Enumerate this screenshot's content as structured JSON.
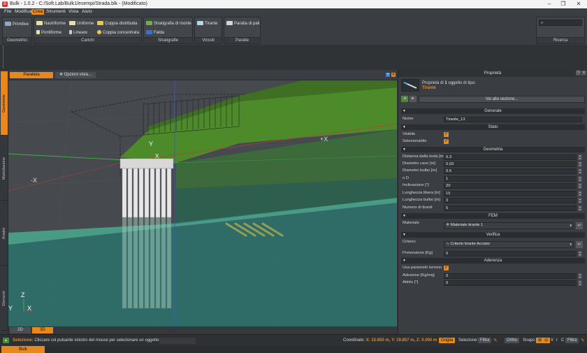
{
  "window": {
    "app_icon": "B",
    "title": "Bulk - 1.0.2 - C:/Soft.Lab/Bulk1/esempi/Strada.blk - (Modificato)",
    "minimize_glyph": "–",
    "maximize_glyph": "❐",
    "close_glyph": "✕"
  },
  "menu": [
    "File",
    "Modifica",
    "Crea",
    "Strumenti",
    "Vista",
    "Aiuto"
  ],
  "menu_active_index": 2,
  "ribbon": {
    "geometrici": {
      "label": "Geometrici",
      "primitive": "Primitive"
    },
    "carichi": {
      "label": "Carichi",
      "nastriforme": "Nastriforme",
      "uniforme": "Uniforme",
      "coppia_distribuita": "Coppia distribuita",
      "puntiforme": "Puntiforme",
      "lineare": "Lineare",
      "coppia_concentrata": "Coppia concentrata"
    },
    "stratigrafie": {
      "label": "Stratigrafie",
      "stratigrafia_monte": "Stratigrafia di monte",
      "falda": "Falda"
    },
    "vincoli": {
      "label": "Vincoli",
      "tirante": "Tirante"
    },
    "paratie": {
      "label": "Paratie",
      "paratia_pali": "Paratia di pali"
    },
    "ricerca": {
      "label": "Ricerca"
    }
  },
  "vertical_tabs": [
    "Geometrie",
    "Modellazione",
    "Analisi",
    "Elementi"
  ],
  "viewport": {
    "projection_tab": "Parallela",
    "options_tab": "Opzioni vista...",
    "view_2d": "2D",
    "view_3d": "3D",
    "axis_labels": {
      "y_top": "Y",
      "x_top": "X",
      "plus_x": "+X",
      "minus_x": "-X",
      "gizmo_z": "Z",
      "gizmo_y": "Y",
      "gizmo_x": "X"
    }
  },
  "properties": {
    "title": "Proprietà",
    "header_prefix": "Proprietà di",
    "header_count": "1",
    "header_suffix": "oggetto di tipo:",
    "object_type": "Tirante",
    "goto_section": "Vai alla sezione...",
    "sections": {
      "generale": "Generale",
      "stato": "Stato",
      "geometria": "Geometria",
      "fem": "FEM",
      "verifica": "Verifica",
      "aderenza": "Aderenza"
    },
    "fields": {
      "nome_label": "Nome",
      "nome_value": "Tirante_13",
      "visibile_label": "Visibile",
      "selezionabile_label": "Selezionabile",
      "distanza_label": "Distanza dalla testa [m]",
      "distanza_value": "0.3",
      "diametro_cavo_label": "Diametro cavo [m]",
      "diametro_cavo_value": "0.03",
      "diametro_bulbo_label": "Diametro bulbo [m]",
      "diametro_bulbo_value": "0.5",
      "od_label": "o D",
      "od_value": "1",
      "inclinazione_label": "Inclinazione [°]",
      "inclinazione_value": "20",
      "lung_libera_label": "Lunghezza libera [m]",
      "lung_libera_value": "15",
      "lung_bulbo_label": "Lunghezza bulbo [m]",
      "lung_bulbo_value": "3",
      "num_tiranti_label": "Numero di tiranti",
      "num_tiranti_value": "5",
      "materiale_label": "Materiale",
      "materiale_value": "Materiale tirante 1",
      "criterio_label": "Criterio",
      "criterio_value": "Criterio tirante Acciaio",
      "pretensione_label": "Pretensione [Kg]",
      "pretensione_value": "0",
      "usa_param_label": "Usa parametri terreno",
      "adesione_label": "Adesione [Kg/mq]",
      "adesione_value": "0",
      "attrito_label": "Attrito [°]",
      "attrito_value": "0"
    }
  },
  "status": {
    "selezione_label": "Selezione:",
    "selezione_text": "Cliccare col pulsante sinistro del mouse per selezionare un oggetto",
    "coords_label": "Coordinate:",
    "coords_value": "X: 32.650 m, Y: 19.857 m, Z: 0.000 m",
    "griglia": "Griglia",
    "selezione2": "Selezione:",
    "filtra": "Filtra",
    "ortho": "Ortho",
    "snaps": "Snaps:",
    "snap_v": "V",
    "snap_i": "I",
    "snap_c": "C",
    "filtra2": "Filtra"
  },
  "bottom_tab": "Bulk",
  "colors": {
    "accent": "#e8871e",
    "terrain_top": "#4c8a2a",
    "terrain_side": "#3e8a70",
    "water": "#2f8a8a"
  }
}
